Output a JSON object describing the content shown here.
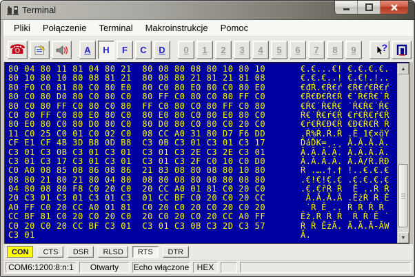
{
  "window": {
    "title": "Terminal"
  },
  "menu": {
    "items": [
      {
        "label": "Pliki"
      },
      {
        "label": "Połączenie"
      },
      {
        "label": "Terminal"
      },
      {
        "label": "Makroinstrukcje"
      },
      {
        "label": "Pomoc"
      }
    ]
  },
  "toolbar": {
    "phone_glyph": "☎",
    "help_glyph": "?",
    "letters": [
      {
        "label": "A",
        "underline": true,
        "pressed": false
      },
      {
        "label": "H",
        "underline": false,
        "pressed": true
      },
      {
        "label": "F",
        "underline": false,
        "pressed": false
      },
      {
        "label": "C",
        "underline": false,
        "pressed": false
      },
      {
        "label": "D",
        "underline": true,
        "pressed": false
      }
    ],
    "digits": [
      "0",
      "1",
      "2",
      "3",
      "4",
      "5",
      "6",
      "7",
      "8",
      "9"
    ]
  },
  "icons": {
    "scroll_up": "▲",
    "scroll_down": "▼"
  },
  "terminal": {
    "rows": [
      {
        "hex": "80 04 80 11 81 04 80 21  80 08 80 08 80 10 80 10",
        "ascii": "€.€...€! €.€.€.€."
      },
      {
        "hex": "80 10 80 10 80 08 81 21  80 08 80 21 81 21 81 08",
        "ascii": "€.€.€..! €.€!.!.."
      },
      {
        "hex": "80 F0 C0 81 80 C0 80 E0  80 C0 80 E0 80 C0 80 E0",
        "ascii": "€đŔ.€Ŕ€ŕ €Ŕ€ŕ€Ŕ€ŕ"
      },
      {
        "hex": "80 C0 80 D0 80 C0 80 C0  80 FF C0 80 C0 80 FF C0",
        "ascii": "€Ŕ€Đ€Ŕ€Ŕ €˙Ŕ€Ŕ€˙Ŕ"
      },
      {
        "hex": "80 C0 80 FF C0 80 C0 80  FF C0 80 C0 80 FF C0 80",
        "ascii": "€Ŕ€˙Ŕ€Ŕ€ ˙Ŕ€Ŕ€˙Ŕ€"
      },
      {
        "hex": "C0 80 FF C0 80 E0 80 C0  80 E0 80 C0 80 E0 80 C0",
        "ascii": "Ŕ€˙Ŕ€ŕ€Ŕ €ŕ€Ŕ€ŕ€Ŕ"
      },
      {
        "hex": "80 E0 80 C0 80 D0 80 C0  80 D0 80 C0 80 C0 20 C0",
        "ascii": "€ŕ€Ŕ€Đ€Ŕ €Đ€Ŕ€Ŕ Ŕ"
      },
      {
        "hex": "11 C0 25 C0 01 C0 02 C0  08 CC A0 31 80 D7 F6 DD",
        "ascii": ".Ŕ%Ŕ.Ŕ.Ŕ .Ě 1€×öÝ"
      },
      {
        "hex": "CF E1 CF 4B 3D B8 0D B8  C3 0B C3 01 C3 01 C3 17",
        "ascii": "ĎáĎK=¸.¸ Ă.Ă.Ă.Ă."
      },
      {
        "hex": "C3 01 C3 0B C3 01 C3 01  C3 01 C3 2E C3 2E C3 01",
        "ascii": "Ă.Ă.Ă.Ă. Ă.Ă.Ă.Ă."
      },
      {
        "hex": "C3 01 C3 17 C3 01 C3 01  C3 01 C3 2F C0 10 C0 D0",
        "ascii": "Ă.Ă.Ă.Ă. Ă.Ă/Ŕ.ŔĐ"
      },
      {
        "hex": "C0 A0 08 85 08 86 08 86  21 83 08 80 08 80 10 80",
        "ascii": "Ŕ .….†.† !..€.€.€"
      },
      {
        "hex": "08 80 21 80 21 80 04 80  08 80 08 80 08 80 08 80",
        "ascii": ".€!€!€.€ .€.€.€.€"
      },
      {
        "hex": "04 80 08 80 F8 C0 20 C0  20 CC A0 01 81 C0 20 C0",
        "ascii": ".€.€řŔ Ŕ  Ě ..Ŕ Ŕ"
      },
      {
        "hex": "20 C3 01 C3 01 C3 01 C3  01 CC BF C0 20 C0 20 CC",
        "ascii": " Ă.Ă.Ă.Ă .ĚżŔ Ŕ Ě"
      },
      {
        "hex": "A0 FF C0 20 CC A0 01 81  C0 20 C0 20 C0 20 C0 20",
        "ascii": " ˙Ŕ Ě .. Ŕ Ŕ Ŕ Ŕ "
      },
      {
        "hex": "CC BF 81 C0 20 C0 20 C0  20 C0 20 C0 20 CC A0 FF",
        "ascii": "Ěż.Ŕ Ŕ Ŕ  Ŕ Ŕ Ě ˙"
      },
      {
        "hex": "C0 20 C0 20 CC BF C3 01  C3 01 C3 0B C3 2D C3 57",
        "ascii": "Ŕ Ŕ ĚżĂ. Ă.Ă.Ă-ĂW"
      },
      {
        "hex": "C3 01",
        "ascii": "Ă."
      }
    ]
  },
  "indicators": [
    {
      "label": "CON",
      "state": "on"
    },
    {
      "label": "CTS",
      "state": "raised"
    },
    {
      "label": "DSR",
      "state": "raised"
    },
    {
      "label": "RLSD",
      "state": "raised"
    },
    {
      "label": "RTS",
      "state": "pressed"
    },
    {
      "label": "DTR",
      "state": "raised"
    }
  ],
  "statusbar": {
    "panels": [
      {
        "text": "COM6:1200:8:n:1"
      },
      {
        "text": "Otwarty"
      },
      {
        "text": "Echo włączone"
      },
      {
        "text": "HEX"
      },
      {
        "text": ""
      },
      {
        "text": ""
      }
    ]
  },
  "colors": {
    "terminal_bg": "#0000A0",
    "terminal_text": "#FFFF00",
    "indicator_on": "#FFFF00",
    "close_button_red": "#C24A33"
  }
}
